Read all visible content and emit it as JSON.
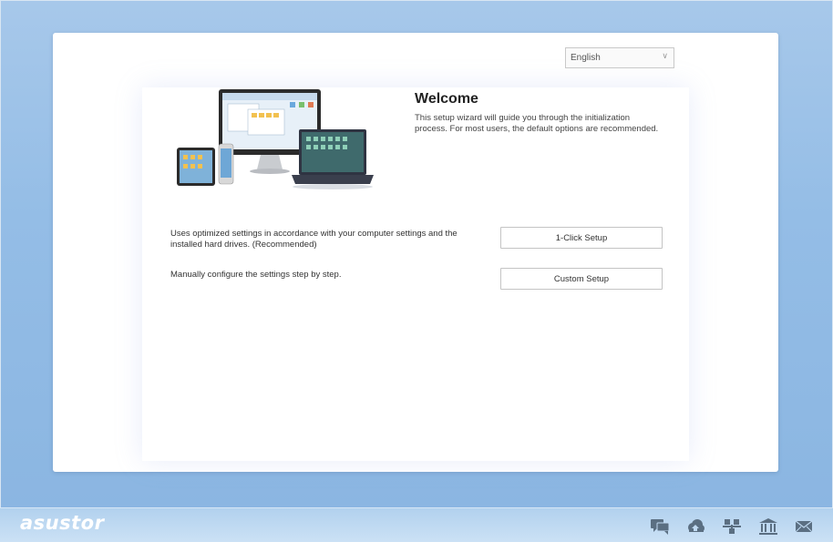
{
  "language": {
    "selected": "English"
  },
  "welcome": {
    "title": "Welcome",
    "description": "This setup wizard will guide you through the initialization process. For most users, the default options are recommended."
  },
  "options": {
    "one_click": {
      "description": "Uses optimized settings in accordance with your computer settings and the installed hard drives. (Recommended)",
      "button_label": "1-Click Setup"
    },
    "custom": {
      "description": "Manually configure the settings step by step.",
      "button_label": "Custom Setup"
    }
  },
  "footer": {
    "logo": "asustor",
    "icons": [
      "chat-icon",
      "cloud-icon",
      "network-icon",
      "building-icon",
      "mail-icon"
    ]
  },
  "colors": {
    "background": "#94bde6",
    "footer": "#c0daf2",
    "icon": "#5b6f82"
  }
}
